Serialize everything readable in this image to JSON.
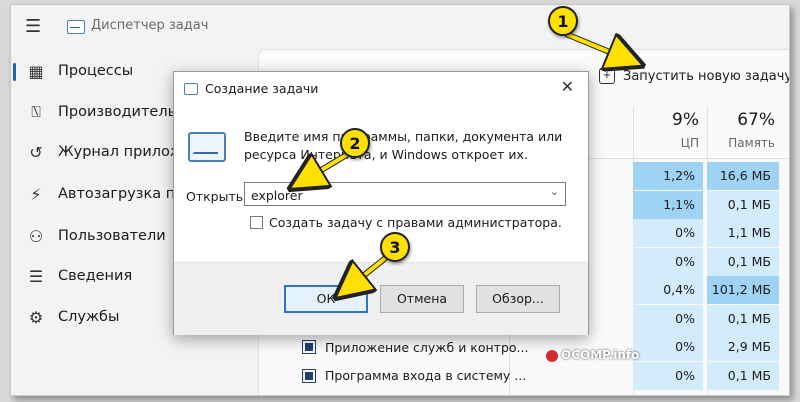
{
  "app": {
    "title": "Диспетчер задач"
  },
  "sidebar": {
    "items": [
      {
        "label": "Процессы",
        "icon": "processes-icon",
        "selected": true
      },
      {
        "label": "Производитель",
        "icon": "performance-icon"
      },
      {
        "label": "Журнал прилож",
        "icon": "history-icon"
      },
      {
        "label": "Автозагрузка пр",
        "icon": "startup-icon"
      },
      {
        "label": "Пользователи",
        "icon": "users-icon"
      },
      {
        "label": "Сведения",
        "icon": "details-icon"
      },
      {
        "label": "Службы",
        "icon": "services-icon"
      }
    ]
  },
  "toolbar": {
    "run_new_task": "Запустить новую задачу"
  },
  "table": {
    "columns": [
      {
        "percent": "9%",
        "label": "ЦП"
      },
      {
        "percent": "67%",
        "label": "Память"
      }
    ],
    "rows": [
      {
        "name": "",
        "cpu": "1,2%",
        "memory": "16,6 МБ"
      },
      {
        "name": "",
        "cpu": "1,1%",
        "memory": "0,1 МБ"
      },
      {
        "name": "",
        "cpu": "0%",
        "memory": "1,1 МБ"
      },
      {
        "name": "",
        "cpu": "0%",
        "memory": "0,1 МБ"
      },
      {
        "name": "",
        "cpu": "0,4%",
        "memory": "101,2 МБ"
      },
      {
        "name": "",
        "cpu": "0%",
        "memory": "0,1 МБ"
      },
      {
        "name": "Приложение служб и контро...",
        "cpu": "0%",
        "memory": "2,9 МБ"
      },
      {
        "name": "Программа входа в систему ...",
        "cpu": "0%",
        "memory": "0,1 МБ"
      }
    ]
  },
  "dialog": {
    "title": "Создание задачи",
    "description": "Введите имя программы, папки, документа или ресурса Интернета, и Windows откроет их.",
    "open_label": "Открыть:",
    "open_value": "explorer",
    "admin_checkbox": "Создать задачу с правами администратора.",
    "ok": "ОК",
    "cancel": "Отмена",
    "browse": "Обзор..."
  },
  "annotations": {
    "step1": "1",
    "step2": "2",
    "step3": "3"
  },
  "watermark": "OCOMP.info",
  "colors": {
    "accent": "#1f5fb4",
    "heat_strong": "#9fd3f5",
    "heat_light": "#d3ecfb",
    "annotation": "#ffe000"
  }
}
